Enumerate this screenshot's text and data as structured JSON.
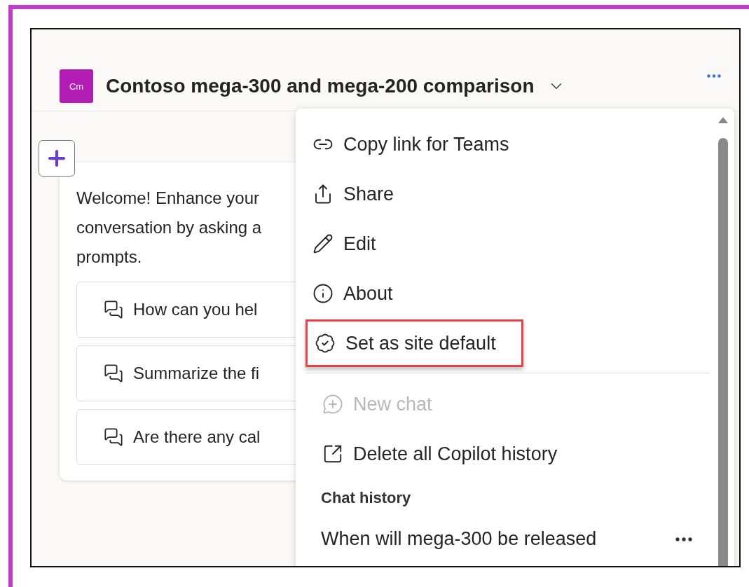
{
  "header": {
    "avatar": "Cm",
    "title": "Contoso mega-300 and mega-200 comparison"
  },
  "welcome": {
    "message": "Welcome! Enhance your conversation by asking a prompts.",
    "prompts": [
      "How can you hel",
      "Summarize the fi",
      "Are there any cal"
    ]
  },
  "menu": {
    "items": [
      {
        "label": "Copy link for Teams",
        "disabled": false,
        "highlighted": false
      },
      {
        "label": "Share",
        "disabled": false,
        "highlighted": false
      },
      {
        "label": "Edit",
        "disabled": false,
        "highlighted": false
      },
      {
        "label": "About",
        "disabled": false,
        "highlighted": false
      },
      {
        "label": "Set as site default",
        "disabled": false,
        "highlighted": true
      }
    ],
    "actions": [
      {
        "label": "New chat",
        "disabled": true
      },
      {
        "label": "Delete all Copilot history",
        "disabled": false
      }
    ],
    "history_heading": "Chat history",
    "history": [
      {
        "label": "When will mega-300 be released"
      }
    ]
  }
}
